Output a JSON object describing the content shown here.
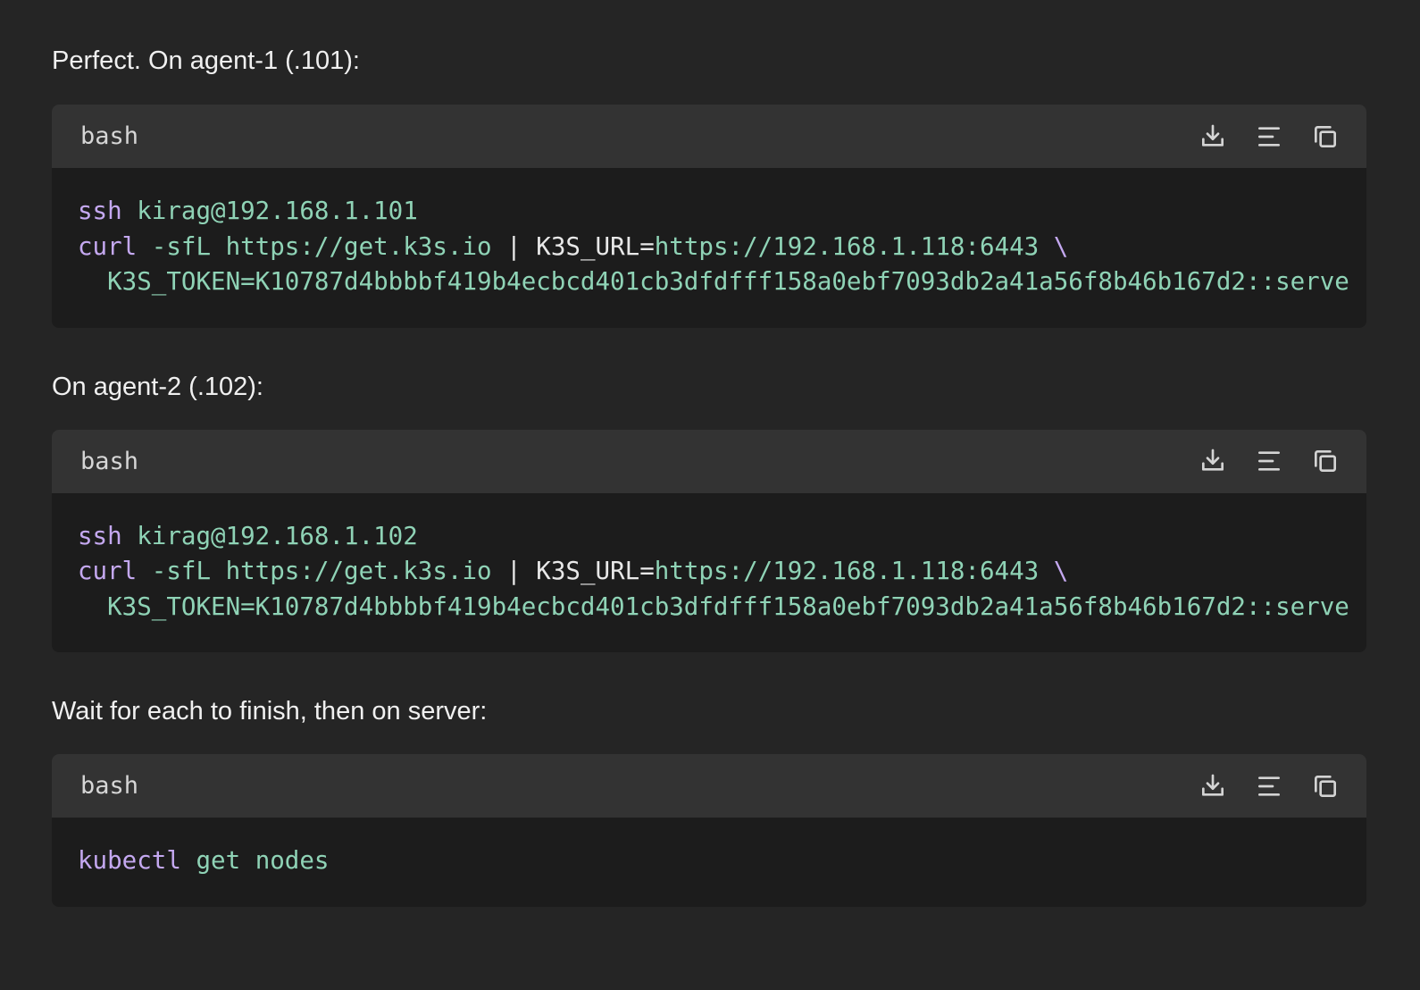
{
  "messages": [
    {
      "text": "Perfect. On agent-1 (.101):",
      "code": {
        "language": "bash",
        "lines": [
          [
            {
              "t": "ssh",
              "k": "cmd"
            },
            {
              "t": " kirag@192.168.1.101",
              "k": "str"
            }
          ],
          [
            {
              "t": "curl",
              "k": "cmd"
            },
            {
              "t": " -sfL https://get.k3s.io ",
              "k": "str"
            },
            {
              "t": "| ",
              "k": "plain"
            },
            {
              "t": "K3S_URL",
              "k": "plain"
            },
            {
              "t": "=",
              "k": "plain"
            },
            {
              "t": "https://192.168.1.118:6443 ",
              "k": "str"
            },
            {
              "t": "\\",
              "k": "cmd"
            }
          ],
          [
            {
              "t": "  K3S_TOKEN=K10787d4bbbbf419b4ecbcd401cb3dfdfff158a0ebf7093db2a41a56f8b46b167d2::serve",
              "k": "str"
            }
          ]
        ]
      }
    },
    {
      "text": "On agent-2 (.102):",
      "code": {
        "language": "bash",
        "lines": [
          [
            {
              "t": "ssh",
              "k": "cmd"
            },
            {
              "t": " kirag@192.168.1.102",
              "k": "str"
            }
          ],
          [
            {
              "t": "curl",
              "k": "cmd"
            },
            {
              "t": " -sfL https://get.k3s.io ",
              "k": "str"
            },
            {
              "t": "| ",
              "k": "plain"
            },
            {
              "t": "K3S_URL",
              "k": "plain"
            },
            {
              "t": "=",
              "k": "plain"
            },
            {
              "t": "https://192.168.1.118:6443 ",
              "k": "str"
            },
            {
              "t": "\\",
              "k": "cmd"
            }
          ],
          [
            {
              "t": "  K3S_TOKEN=K10787d4bbbbf419b4ecbcd401cb3dfdfff158a0ebf7093db2a41a56f8b46b167d2::serve",
              "k": "str"
            }
          ]
        ]
      }
    },
    {
      "text": "Wait for each to finish, then on server:",
      "code": {
        "language": "bash",
        "lines": [
          [
            {
              "t": "kubectl",
              "k": "cmd"
            },
            {
              "t": " get nodes",
              "k": "str"
            }
          ]
        ]
      }
    }
  ],
  "icons": {
    "download": "download-icon",
    "wrap": "wrap-lines-icon",
    "copy": "copy-icon"
  },
  "colors": {
    "background": "#252525",
    "code_header": "#333333",
    "code_body": "#1c1c1c",
    "command": "#c4a8f0",
    "string": "#8fd3b6",
    "plain": "#e8e8e8"
  }
}
